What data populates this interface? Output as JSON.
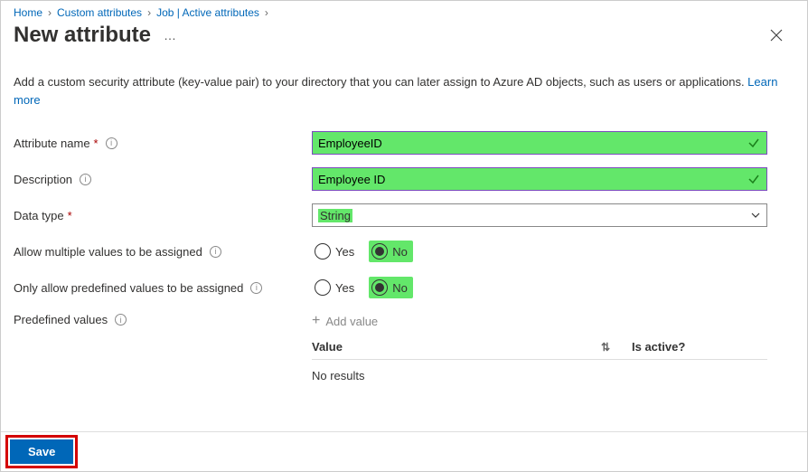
{
  "breadcrumb": {
    "home": "Home",
    "customAttributes": "Custom attributes",
    "job": "Job | Active attributes"
  },
  "header": {
    "title": "New attribute"
  },
  "intro": {
    "text": "Add a custom security attribute (key-value pair) to your directory that you can later assign to Azure AD objects, such as users or applications.  ",
    "learnMore": "Learn more"
  },
  "form": {
    "attributeName": {
      "label": "Attribute name",
      "value": "EmployeeID"
    },
    "description": {
      "label": "Description",
      "value": "Employee ID"
    },
    "dataType": {
      "label": "Data type",
      "value": "String"
    },
    "allowMultiple": {
      "label": "Allow multiple values to be assigned",
      "yes": "Yes",
      "no": "No",
      "selected": "no"
    },
    "onlyPredefined": {
      "label": "Only allow predefined values to be assigned",
      "yes": "Yes",
      "no": "No",
      "selected": "no"
    },
    "predefined": {
      "label": "Predefined values",
      "addValue": "Add value",
      "columns": {
        "value": "Value",
        "isActive": "Is active?"
      },
      "noResults": "No results"
    }
  },
  "footer": {
    "save": "Save"
  }
}
